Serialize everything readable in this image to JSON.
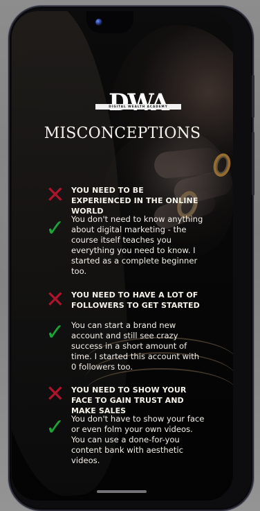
{
  "brand": {
    "logo_text": "DWA",
    "academy_text": "DIGITAL WEALTH ACADEMY"
  },
  "page": {
    "title": "MISCONCEPTIONS"
  },
  "items": [
    {
      "wrong_icon": "x-icon",
      "right_icon": "check-icon",
      "heading": "YOU NEED TO BE EXPERIENCED IN THE ONLINE WORLD",
      "body": "You don't need to know anything about digital marketing - the course itself teaches you everything you need to know. I started as a complete beginner too."
    },
    {
      "wrong_icon": "x-icon",
      "right_icon": "check-icon",
      "heading": "YOU NEED TO HAVE A LOT OF FOLLOWERS TO GET STARTED",
      "body": "You can start a brand new account and still see crazy success in a short amount of time. I started this account with 0 followers too."
    },
    {
      "wrong_icon": "x-icon",
      "right_icon": "check-icon",
      "heading": "YOU NEED TO SHOW YOUR FACE TO GAIN TRUST AND MAKE SALES",
      "body": "You don't have to show your face or even folm your own videos. You can use a done-for-you content bank with aesthetic videos."
    }
  ],
  "colors": {
    "accent_red": "#b0142c",
    "accent_green": "#1aa338",
    "text_light": "#f4f1ea",
    "phone_frame": "#0d0d10"
  }
}
